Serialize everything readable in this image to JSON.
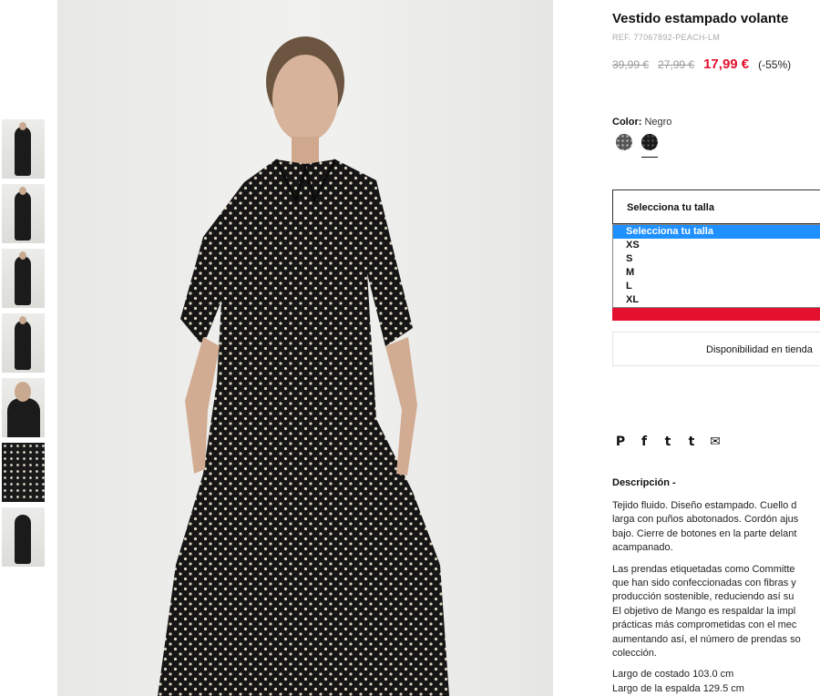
{
  "thumbnails": [
    {
      "icon": "model-front-thumbnail"
    },
    {
      "icon": "model-side-thumbnail"
    },
    {
      "icon": "model-back-thumbnail"
    },
    {
      "icon": "model-detail-thumbnail"
    },
    {
      "icon": "model-face-thumbnail"
    },
    {
      "icon": "fabric-print-thumbnail"
    },
    {
      "icon": "product-flat-thumbnail"
    }
  ],
  "product": {
    "title": "Vestido estampado volante",
    "ref": "REF. 77067892-PEACH-LM",
    "price_original": "39,99 €",
    "price_previous": "27,99 €",
    "price_current": "17,99 €",
    "discount": "(-55%)",
    "sale_color": "#e3102e"
  },
  "color": {
    "label": "Color:",
    "value": "Negro",
    "swatches": [
      {
        "name": "dotted-grey-swatch"
      },
      {
        "name": "black-swatch",
        "selected": true
      }
    ]
  },
  "size": {
    "placeholder": "Selecciona tu talla",
    "options": [
      "Selecciona tu talla",
      "XS",
      "S",
      "M",
      "L",
      "XL"
    ],
    "highlighted_option": "Selecciona tu talla",
    "highlight_color": "#1e90ff"
  },
  "availability_label": "Disponibilidad en tienda",
  "social": {
    "icons": [
      "pinterest-icon",
      "facebook-icon",
      "twitter-icon",
      "tumblr-icon",
      "email-icon"
    ],
    "glyphs": [
      "P",
      "f",
      "t",
      "t",
      "✉"
    ]
  },
  "description": {
    "title": "Descripción -",
    "paragraph1": "Tejido fluido. Diseño estampado. Cuello d\nlarga con puños abotonados. Cordón ajus\nbajo. Cierre de botones en la parte delant\nacampanado.",
    "paragraph2": "Las prendas etiquetadas como Committe\nque han sido confeccionadas con fibras y\nproducción sostenible, reduciendo así su\nEl objetivo de Mango es respaldar la impl\nprácticas más comprometidas con el mec\naumentando así, el número de prendas so\ncolección.",
    "measure1": "Largo de costado 103.0 cm",
    "measure2": "Largo de la espalda 129.5 cm"
  }
}
